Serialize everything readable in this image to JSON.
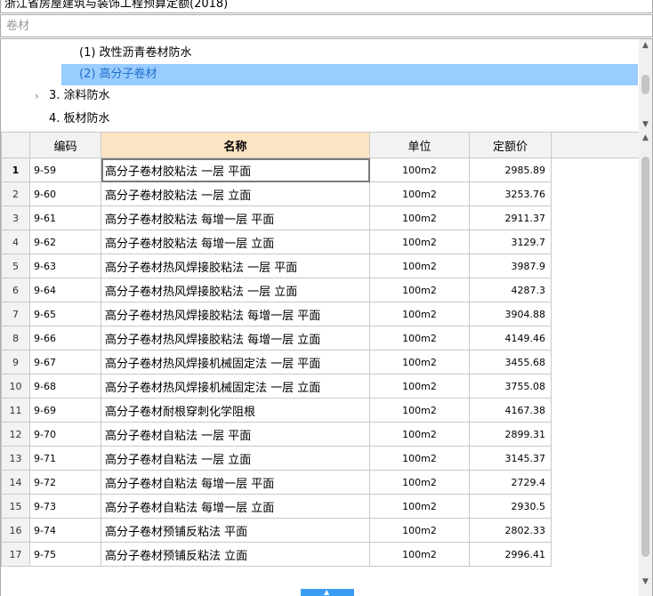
{
  "top_select": {
    "text": "浙江省房屋建筑与装饰工程预算定额(2018)"
  },
  "filter": {
    "placeholder": "卷材",
    "value": ""
  },
  "tree": {
    "items": [
      {
        "label": "(1) 改性沥青卷材防水",
        "selected": false
      },
      {
        "label": "(2) 高分子卷材",
        "selected": true
      },
      {
        "label": "3. 涂料防水",
        "selected": false,
        "expandable": true
      },
      {
        "label": "4. 板材防水",
        "selected": false
      }
    ]
  },
  "table": {
    "columns": [
      "编码",
      "名称",
      "单位",
      "定额价"
    ],
    "rows": [
      {
        "no": "1",
        "code": "9-59",
        "name": "高分子卷材胶粘法 一层 平面",
        "unit": "100m2",
        "price": "2985.89"
      },
      {
        "no": "2",
        "code": "9-60",
        "name": "高分子卷材胶粘法 一层 立面",
        "unit": "100m2",
        "price": "3253.76"
      },
      {
        "no": "3",
        "code": "9-61",
        "name": "高分子卷材胶粘法 每增一层 平面",
        "unit": "100m2",
        "price": "2911.37"
      },
      {
        "no": "4",
        "code": "9-62",
        "name": "高分子卷材胶粘法 每增一层 立面",
        "unit": "100m2",
        "price": "3129.7"
      },
      {
        "no": "5",
        "code": "9-63",
        "name": "高分子卷材热风焊接胶粘法 一层 平面",
        "unit": "100m2",
        "price": "3987.9"
      },
      {
        "no": "6",
        "code": "9-64",
        "name": "高分子卷材热风焊接胶粘法 一层 立面",
        "unit": "100m2",
        "price": "4287.3"
      },
      {
        "no": "7",
        "code": "9-65",
        "name": "高分子卷材热风焊接胶粘法 每增一层 平面",
        "unit": "100m2",
        "price": "3904.88"
      },
      {
        "no": "8",
        "code": "9-66",
        "name": "高分子卷材热风焊接胶粘法 每增一层 立面",
        "unit": "100m2",
        "price": "4149.46"
      },
      {
        "no": "9",
        "code": "9-67",
        "name": "高分子卷材热风焊接机械固定法 一层 平面",
        "unit": "100m2",
        "price": "3455.68"
      },
      {
        "no": "10",
        "code": "9-68",
        "name": "高分子卷材热风焊接机械固定法 一层 立面",
        "unit": "100m2",
        "price": "3755.08"
      },
      {
        "no": "11",
        "code": "9-69",
        "name": "高分子卷材耐根穿刺化学阻根",
        "unit": "100m2",
        "price": "4167.38"
      },
      {
        "no": "12",
        "code": "9-70",
        "name": "高分子卷材自粘法 一层 平面",
        "unit": "100m2",
        "price": "2899.31"
      },
      {
        "no": "13",
        "code": "9-71",
        "name": "高分子卷材自粘法 一层 立面",
        "unit": "100m2",
        "price": "3145.37"
      },
      {
        "no": "14",
        "code": "9-72",
        "name": "高分子卷材自粘法 每增一层 平面",
        "unit": "100m2",
        "price": "2729.4"
      },
      {
        "no": "15",
        "code": "9-73",
        "name": "高分子卷材自粘法 每增一层 立面",
        "unit": "100m2",
        "price": "2930.5"
      },
      {
        "no": "16",
        "code": "9-74",
        "name": "高分子卷材预铺反粘法 平面",
        "unit": "100m2",
        "price": "2802.33"
      },
      {
        "no": "17",
        "code": "9-75",
        "name": "高分子卷材预铺反粘法 立面",
        "unit": "100m2",
        "price": "2996.41"
      }
    ]
  },
  "icons": {
    "up": "arrow-up-icon",
    "down": "arrow-down-icon",
    "expand": "chevron-right-icon"
  },
  "colors": {
    "selection": "#99ccff",
    "active_header": "#fde4c4",
    "accent": "#3b9cf3"
  }
}
